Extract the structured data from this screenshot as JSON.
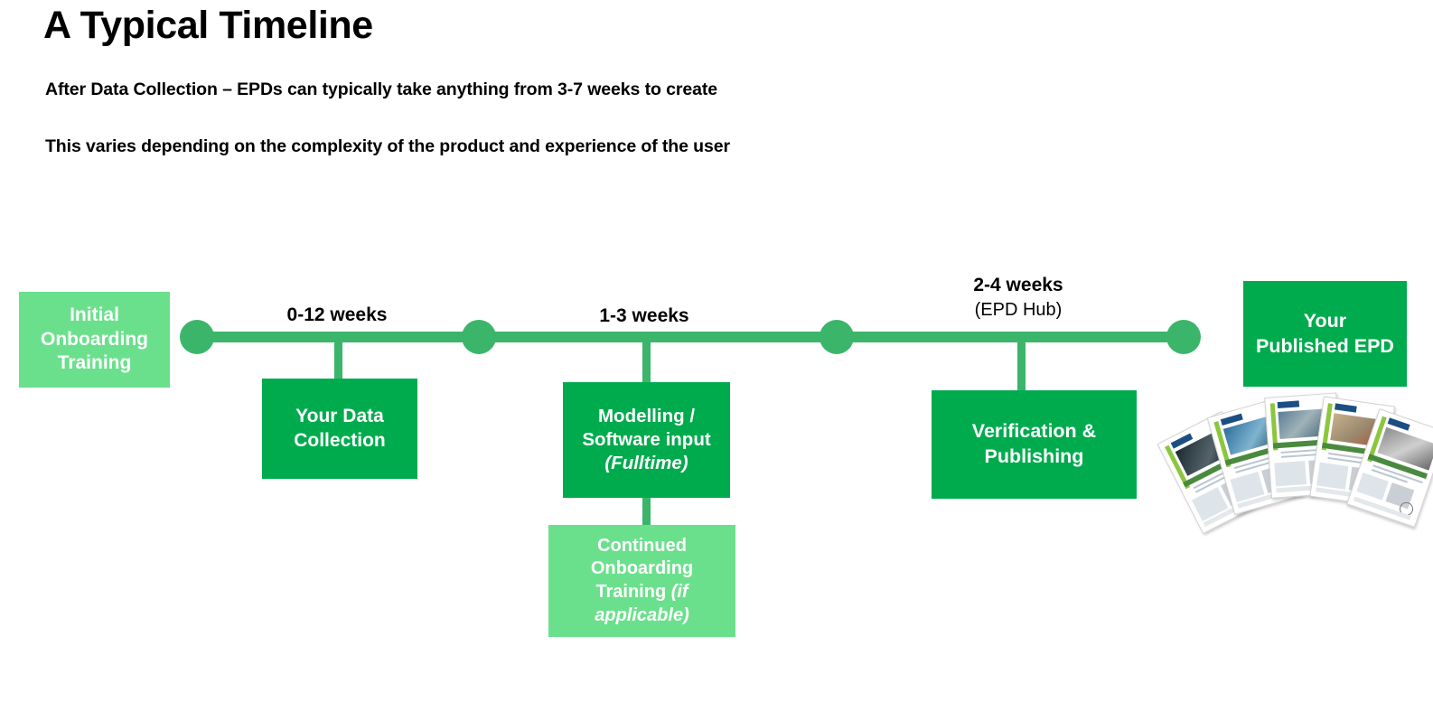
{
  "header": {
    "title": "A Typical Timeline",
    "subtitle_1": "After Data Collection – EPDs can typically take anything from 3-7 weeks to create",
    "subtitle_2": "This varies depending on the complexity of the product and experience of the user"
  },
  "colors": {
    "accent_dark_green": "#00AB4E",
    "accent_light_green": "#6BE08C",
    "rail_green": "#3BB56A",
    "text_black": "#000000",
    "box_text_white": "#FFFFFF"
  },
  "timeline": {
    "durations": [
      {
        "id": "onboarding-to-data",
        "label": "0-12 weeks",
        "sublabel": ""
      },
      {
        "id": "data-to-modelling",
        "label": "1-3 weeks",
        "sublabel": ""
      },
      {
        "id": "modelling-to-publish",
        "label": "2-4 weeks",
        "sublabel": "(EPD Hub)"
      }
    ],
    "nodes": [
      {
        "id": "node-1"
      },
      {
        "id": "node-2"
      },
      {
        "id": "node-3"
      },
      {
        "id": "node-4"
      }
    ],
    "stages": [
      {
        "id": "initial-onboarding-training",
        "lines": [
          "Initial",
          "Onboarding",
          "Training"
        ],
        "note": "",
        "style": "light"
      },
      {
        "id": "your-data-collection",
        "lines": [
          "Your Data",
          "Collection"
        ],
        "note": "",
        "style": "dark"
      },
      {
        "id": "modelling-software-input",
        "lines": [
          "Modelling /",
          "Software input"
        ],
        "note": "(Fulltime)",
        "style": "dark"
      },
      {
        "id": "continued-onboarding-training",
        "lines": [
          "Continued",
          "Onboarding",
          "Training "
        ],
        "note": "(if applicable)",
        "style": "light"
      },
      {
        "id": "verification-and-publishing",
        "lines": [
          "Verification &",
          "Publishing"
        ],
        "note": "",
        "style": "dark"
      },
      {
        "id": "your-published-epd",
        "lines": [
          "Your",
          "Published EPD"
        ],
        "note": "",
        "style": "dark"
      }
    ]
  },
  "artwork": {
    "epd_document_fan": "Fan of five published EPD document front pages"
  }
}
